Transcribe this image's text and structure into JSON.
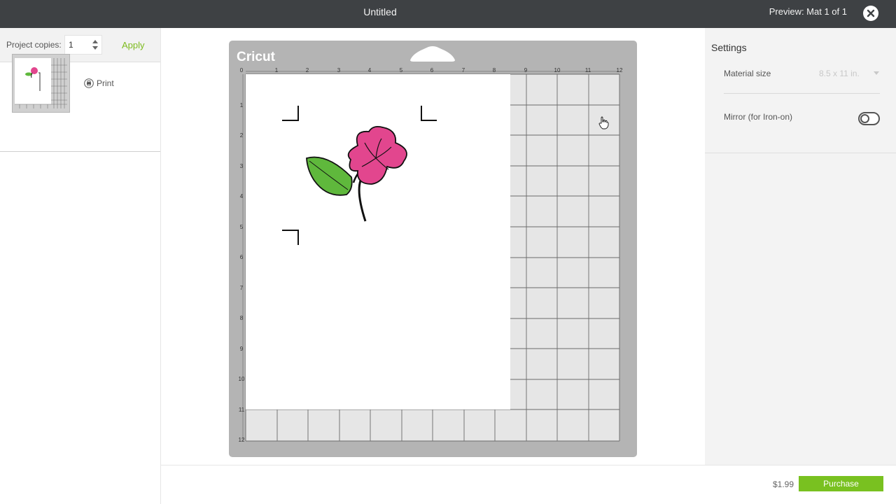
{
  "header": {
    "title": "Untitled",
    "preview": "Preview: Mat 1 of 1"
  },
  "left_panel": {
    "copies_label": "Project copies:",
    "copies_value": "1",
    "apply_label": "Apply",
    "print_label": "Print"
  },
  "mat": {
    "logo": "Cricut",
    "x_ruler": [
      "0",
      "1",
      "2",
      "3",
      "4",
      "5",
      "6",
      "7",
      "8",
      "9",
      "10",
      "11",
      "12"
    ],
    "y_ruler": [
      "1",
      "2",
      "3",
      "4",
      "5",
      "6",
      "7",
      "8",
      "9",
      "10",
      "11",
      "12"
    ],
    "colors": {
      "mat": "#b4b4b4",
      "grid": "#e6e6e6",
      "flower": "#e2468e",
      "leaf": "#5fb83c"
    }
  },
  "settings": {
    "title": "Settings",
    "material_size_label": "Material size",
    "material_size_value": "8.5 x 11 in.",
    "mirror_label": "Mirror (for Iron-on)"
  },
  "footer": {
    "price": "$1.99",
    "purchase_label": "Purchase"
  }
}
